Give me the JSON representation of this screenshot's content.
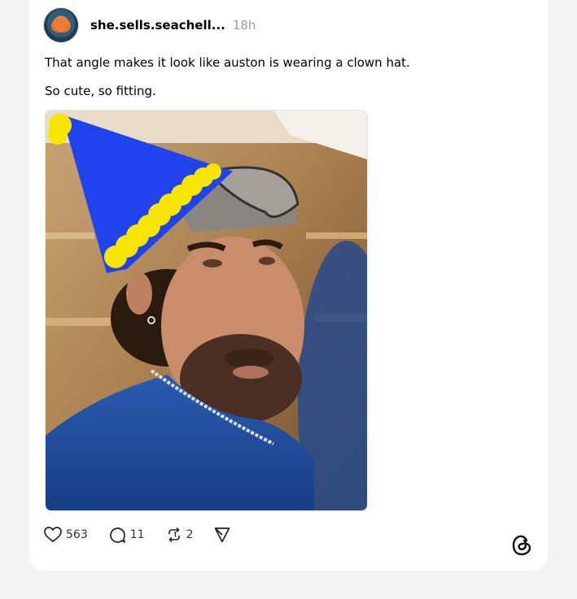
{
  "post": {
    "username": "she.sells.seachell...",
    "timestamp": "18h",
    "text_lines": [
      "That angle makes it look like auston is wearing a clown hat.",
      "So cute, so fitting."
    ]
  },
  "actions": {
    "likes": "563",
    "replies": "11",
    "reposts": "2"
  },
  "icons": [
    "heart-icon",
    "reply-icon",
    "repost-icon",
    "share-icon",
    "threads-logo-icon"
  ],
  "colors": {
    "hat_blue": "#1f44ee",
    "hat_trim_yellow": "#f7e400",
    "jersey_blue": "#1f4f9e"
  }
}
